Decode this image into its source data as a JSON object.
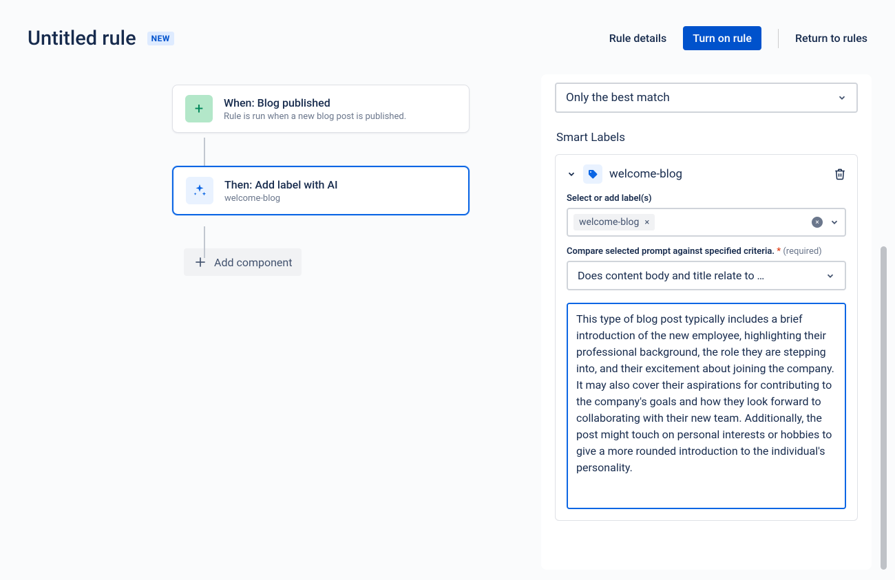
{
  "header": {
    "title": "Untitled rule",
    "badge": "NEW",
    "rule_details": "Rule details",
    "turn_on": "Turn on rule",
    "return": "Return to rules"
  },
  "flow": {
    "when": {
      "title": "When: Blog published",
      "sub": "Rule is run when a new blog post is published."
    },
    "then": {
      "title": "Then: Add label with AI",
      "sub": "welcome-blog"
    },
    "add_component": "Add component"
  },
  "panel": {
    "match_select": "Only the best match",
    "section": "Smart Labels",
    "label_item": {
      "name": "welcome-blog",
      "select_label_text": "Select or add label(s)",
      "chip": "welcome-blog",
      "compare_label": "Compare selected prompt against specified criteria.",
      "required": "(required)",
      "compare_value": "Does content body and title relate to …",
      "criteria_text": "This type of blog post typically includes a brief introduction of the new employee, highlighting their professional background, the role they are stepping into, and their excitement about joining the company. It may also cover their aspirations for contributing to the company's goals and how they look forward to collaborating with their new team. Additionally, the post might touch on personal interests or hobbies to give a more rounded introduction to the individual's personality."
    }
  },
  "icons": {
    "plus": "+",
    "chevron": "⌄",
    "x": "×"
  }
}
